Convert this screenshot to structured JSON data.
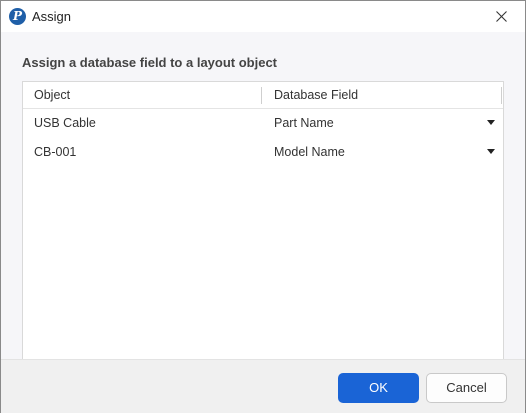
{
  "window": {
    "title": "Assign",
    "app_icon_glyph": "P"
  },
  "instruction": "Assign a database field to a layout object",
  "table": {
    "columns": [
      "Object",
      "Database Field"
    ],
    "rows": [
      {
        "object": "USB Cable",
        "field": "Part Name"
      },
      {
        "object": "CB-001",
        "field": "Model Name"
      }
    ]
  },
  "buttons": {
    "ok": "OK",
    "cancel": "Cancel"
  },
  "colors": {
    "accent": "#1a64d6",
    "app_icon": "#1f5fa8"
  },
  "icons": {
    "app": "app-logo-icon",
    "close": "close-icon",
    "dropdown": "dropdown-arrow-icon"
  }
}
